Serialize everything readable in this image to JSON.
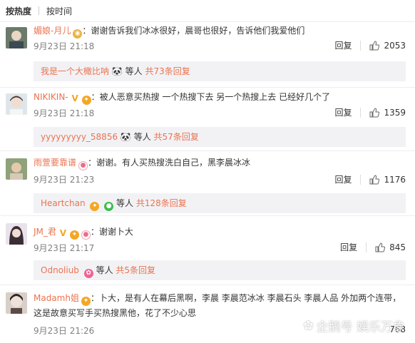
{
  "tabs": {
    "hot": "按热度",
    "time": "按时间"
  },
  "comments": [
    {
      "user": "媚娘-月儿",
      "text": "：谢谢告诉我们冰冰很好，晨哥也很好，告诉他们我爱他们",
      "time": "9月23日 21:18",
      "reply_label": "回复",
      "likes": "2053",
      "replies": {
        "name": "我是一个大橄比呐",
        "mid": "等人",
        "more": "共73条回复"
      }
    },
    {
      "user": "NIKIKIN-",
      "text": "：被人恶意买热搜 一个热搜下去 另一个热搜上去 已经好几个了",
      "time": "9月23日 21:18",
      "reply_label": "回复",
      "likes": "1359",
      "replies": {
        "name": "yyyyyyyyy_58856",
        "mid": "等人",
        "more": "共57条回复"
      }
    },
    {
      "user": "雨萱要靠谱",
      "text": "：谢谢。有人买热搜洗白自己，黑李晨冰冰",
      "time": "9月23日 21:23",
      "reply_label": "回复",
      "likes": "1176",
      "replies": {
        "name": "Heartchan",
        "mid": "等人",
        "more": "共128条回复"
      }
    },
    {
      "user": "JM_君",
      "text": "：谢谢卜大",
      "time": "9月23日 21:17",
      "reply_label": "回复",
      "likes": "845",
      "replies": {
        "name": "Odnoliub",
        "mid": "等人",
        "more": "共5条回复"
      }
    },
    {
      "user": "Madamh姐",
      "text": "：卜大，是有人在幕后黑啊，李晨 李晨范冰冰 李晨石头 李晨人品 外加两个连带，",
      "text2": "这是故意买写手买热搜黑他，花了不少心思",
      "time": "9月23日 21:26",
      "likes": "768"
    }
  ],
  "watermark": "企鹅号 娱乐万象",
  "colors": {
    "username": "#eb7350",
    "time": "#808080",
    "reply_bg": "#f2f2f5"
  }
}
